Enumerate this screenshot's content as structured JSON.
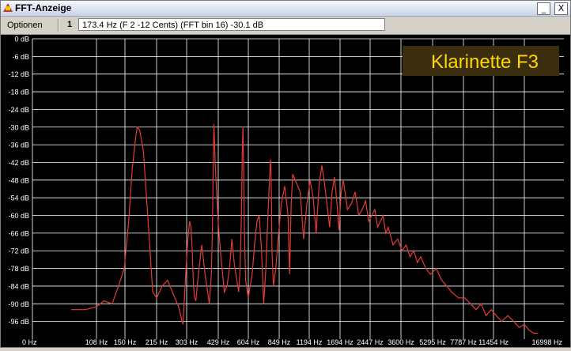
{
  "window": {
    "title": "FFT-Anzeige",
    "minimize_label": "_",
    "close_label": "X",
    "app_icon": "fft-app-icon"
  },
  "menu": {
    "options_label": "Optionen"
  },
  "toolbar": {
    "channel": "1",
    "status_text": "173.4 Hz (F 2 -12 Cents) (FFT bin 16) -30.1 dB"
  },
  "overlay": {
    "label": "Klarinette F3",
    "color": "#ffd700",
    "background": "#3a2e0e"
  },
  "colors": {
    "trace": "#e43c35",
    "grid": "#ffffff",
    "background": "#000000",
    "tick_text": "#ffffff"
  },
  "chart_data": {
    "type": "line",
    "title": "",
    "xlabel": "",
    "ylabel": "",
    "x_scale": "log",
    "grid": true,
    "y_ticks": [
      "0 dB",
      "-6 dB",
      "-12 dB",
      "-18 dB",
      "-24 dB",
      "-30 dB",
      "-36 dB",
      "-42 dB",
      "-48 dB",
      "-54 dB",
      "-60 dB",
      "-66 dB",
      "-72 dB",
      "-78 dB",
      "-84 dB",
      "-90 dB",
      "-96 dB"
    ],
    "y_tick_values": [
      0,
      -6,
      -12,
      -18,
      -24,
      -30,
      -36,
      -42,
      -48,
      -54,
      -60,
      -66,
      -72,
      -78,
      -84,
      -90,
      -96
    ],
    "ylim": [
      -102,
      0
    ],
    "x_ticks": [
      "0 Hz",
      "108 Hz",
      "150 Hz",
      "215 Hz",
      "303 Hz",
      "429 Hz",
      "604 Hz",
      "849 Hz",
      "1194 Hz",
      "1694 Hz",
      "2447 Hz",
      "3600 Hz",
      "5295 Hz",
      "7787 Hz",
      "11454 Hz",
      "16998 Hz"
    ],
    "series": [
      {
        "x": [
          80,
          95,
          108,
          118,
          130,
          140,
          150,
          158,
          165,
          172,
          175,
          180,
          188,
          198,
          210,
          220,
          235,
          250,
          265,
          285,
          300,
          310,
          318,
          325,
          330,
          335,
          340,
          345,
          350,
          360,
          375,
          390,
          410,
          420,
          425,
          430,
          433,
          440,
          455,
          470,
          490,
          505,
          520,
          530,
          535,
          550,
          580,
          590,
          600,
          605,
          610,
          615,
          620,
          630,
          650,
          680,
          700,
          720,
          740,
          760,
          780,
          800,
          820,
          835,
          845,
          850,
          855,
          860,
          875,
          900,
          930,
          960,
          1000,
          1040,
          1060,
          1080,
          1100,
          1200,
          1250,
          1300,
          1350,
          1400,
          1450,
          1500,
          1550,
          1600,
          1700,
          1750,
          1800,
          1850,
          1900,
          1950,
          2000,
          2100,
          2200,
          2300,
          2400,
          2500,
          2600,
          2700,
          2800,
          2900,
          3000,
          3100,
          3200,
          3300,
          3400,
          3600,
          3800,
          4000,
          4200,
          4400,
          4600,
          4800,
          5000,
          5300,
          5600,
          6000,
          6400,
          6800,
          7200,
          7800,
          8400,
          9000,
          9600,
          10200,
          10800,
          11500,
          12200,
          13000,
          14000,
          15000,
          16000,
          17000,
          18000,
          19000,
          20000
        ],
        "y": [
          -92,
          -92,
          -91,
          -89,
          -90,
          -84,
          -78,
          -62,
          -44,
          -33,
          -30,
          -31,
          -38,
          -60,
          -86,
          -88,
          -84,
          -82,
          -86,
          -91,
          -97,
          -80,
          -68,
          -62,
          -64,
          -72,
          -84,
          -88,
          -89,
          -80,
          -70,
          -80,
          -90,
          -80,
          -66,
          -40,
          -29,
          -43,
          -62,
          -74,
          -86,
          -84,
          -78,
          -72,
          -68,
          -76,
          -86,
          -78,
          -58,
          -39,
          -30,
          -43,
          -64,
          -82,
          -88,
          -80,
          -70,
          -62,
          -60,
          -72,
          -90,
          -78,
          -60,
          -48,
          -41,
          -44,
          -56,
          -72,
          -84,
          -78,
          -66,
          -56,
          -50,
          -60,
          -80,
          -56,
          -46,
          -52,
          -68,
          -56,
          -48,
          -54,
          -66,
          -50,
          -43,
          -49,
          -64,
          -52,
          -47,
          -55,
          -65,
          -52,
          -48,
          -58,
          -56,
          -52,
          -60,
          -58,
          -55,
          -62,
          -60,
          -58,
          -64,
          -62,
          -60,
          -66,
          -64,
          -70,
          -68,
          -72,
          -70,
          -74,
          -72,
          -76,
          -74,
          -78,
          -80,
          -78,
          -82,
          -84,
          -86,
          -88,
          -88,
          -90,
          -92,
          -90,
          -94,
          -92,
          -94,
          -96,
          -94,
          -96,
          -98,
          -97,
          -99,
          -100,
          -100
        ]
      }
    ]
  }
}
